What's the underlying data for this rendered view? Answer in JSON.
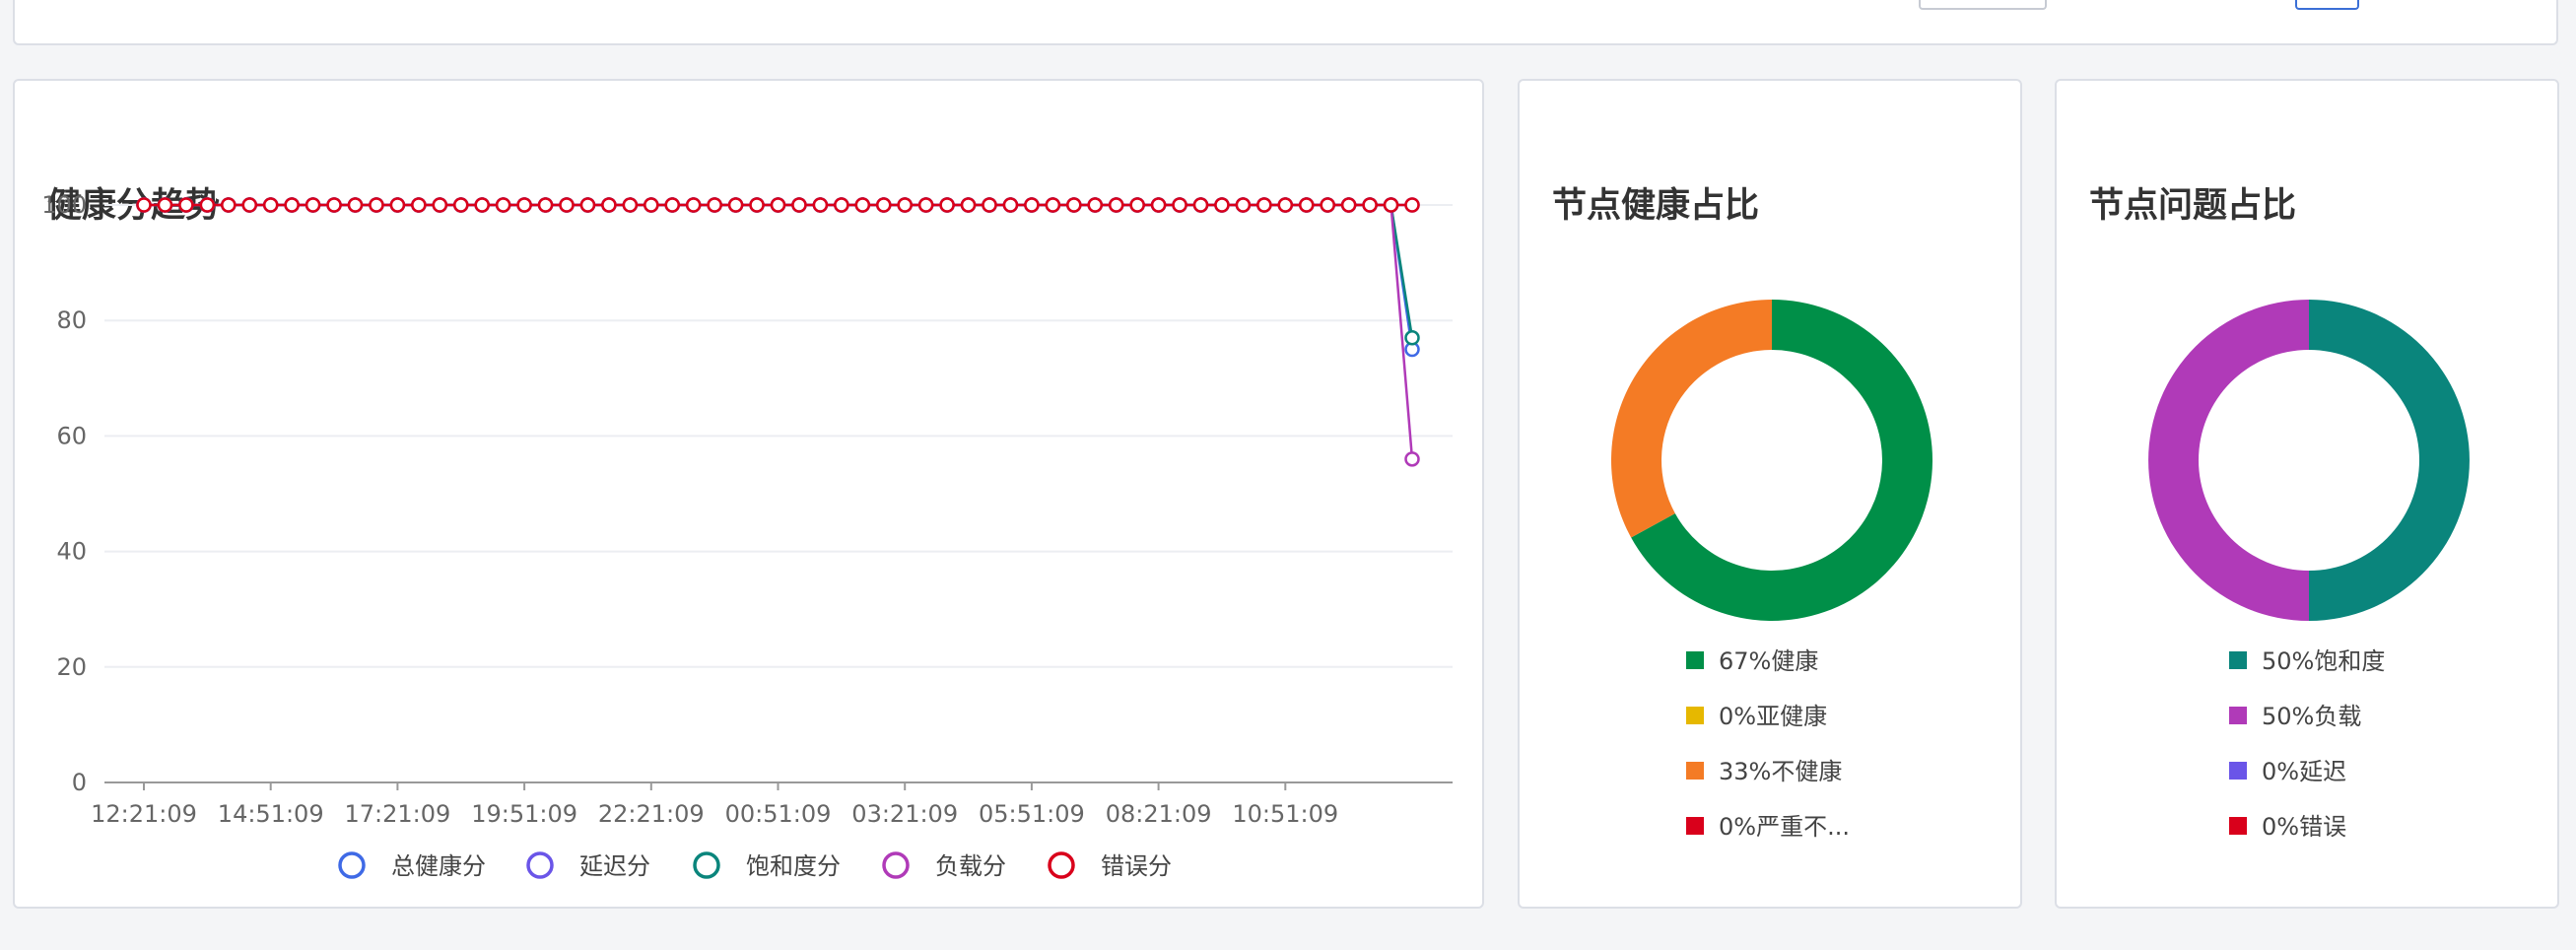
{
  "charts": {
    "trend_title": "健康分趋势",
    "health_title": "节点健康占比",
    "issue_title": "节点问题占比"
  },
  "chart_data": [
    {
      "type": "line",
      "title": "健康分趋势",
      "x_ticks": [
        "12:21:09",
        "14:51:09",
        "17:21:09",
        "19:51:09",
        "22:21:09",
        "00:51:09",
        "03:21:09",
        "05:51:09",
        "08:21:09",
        "10:51:09"
      ],
      "y_ticks": [
        0,
        20,
        40,
        60,
        80,
        100
      ],
      "ylim": [
        0,
        100
      ],
      "x_start": "12:21:09",
      "x_step_minutes": 25,
      "grid": true,
      "legend_position": "bottom",
      "series": [
        {
          "name": "总健康分",
          "color": "#3f6ae6",
          "values_constant": 100,
          "constant_points": 60,
          "last_value": 75
        },
        {
          "name": "延迟分",
          "color": "#6a55e8",
          "values_constant": 100,
          "constant_points": 60,
          "last_value": 100
        },
        {
          "name": "饱和度分",
          "color": "#0a857c",
          "values_constant": 100,
          "constant_points": 60,
          "last_value": 77
        },
        {
          "name": "负载分",
          "color": "#b03ab8",
          "values_constant": 100,
          "constant_points": 60,
          "last_value": 56
        },
        {
          "name": "错误分",
          "color": "#d9001b",
          "values_constant": 100,
          "constant_points": 60,
          "last_value": 100
        }
      ]
    },
    {
      "type": "pie",
      "donut": true,
      "title": "节点健康占比",
      "slices": [
        {
          "label": "67%健康",
          "value": 67,
          "color": "#008f48"
        },
        {
          "label": "0%亚健康",
          "value": 0,
          "color": "#e6b800"
        },
        {
          "label": "33%不健康",
          "value": 33,
          "color": "#f47b25"
        },
        {
          "label": "0%严重不...",
          "value": 0,
          "color": "#d9001b"
        }
      ]
    },
    {
      "type": "pie",
      "donut": true,
      "title": "节点问题占比",
      "slices": [
        {
          "label": "50%饱和度",
          "value": 50,
          "color": "#0a857c"
        },
        {
          "label": "50%负载",
          "value": 50,
          "color": "#b03ab8"
        },
        {
          "label": "0%延迟",
          "value": 0,
          "color": "#6a55e8"
        },
        {
          "label": "0%错误",
          "value": 0,
          "color": "#d9001b"
        }
      ]
    }
  ]
}
